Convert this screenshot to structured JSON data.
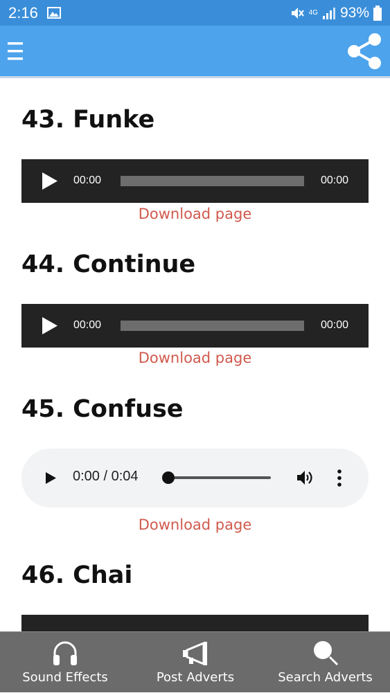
{
  "status_bar": {
    "time": "2:16",
    "battery": "93%",
    "network": "4G"
  },
  "app_bar": {
    "menu_icon": "hamburger-menu-icon",
    "share_icon": "share-icon",
    "color": "#4da3ec"
  },
  "items": [
    {
      "heading": "43. Funke",
      "player": {
        "start": "00:00",
        "end": "00:00"
      },
      "download": "Download page"
    },
    {
      "heading": "44. Continue",
      "player": {
        "start": "00:00",
        "end": "00:00"
      },
      "download": "Download page"
    },
    {
      "heading": "45. Confuse",
      "player": {
        "time": "0:00 / 0:04",
        "progress": 0
      },
      "download": "Download page"
    },
    {
      "heading": "46. Chai"
    }
  ],
  "bottom_nav": [
    {
      "label": "Sound Effects",
      "icon": "headphones-icon"
    },
    {
      "label": "Post Adverts",
      "icon": "megaphone-icon"
    },
    {
      "label": "Search Adverts",
      "icon": "search-icon"
    }
  ],
  "colors": {
    "status_bar": "#3a8ed9",
    "link": "#d05a4d",
    "player_dark": "#232323",
    "bottom_nav": "#6b6b6b"
  }
}
